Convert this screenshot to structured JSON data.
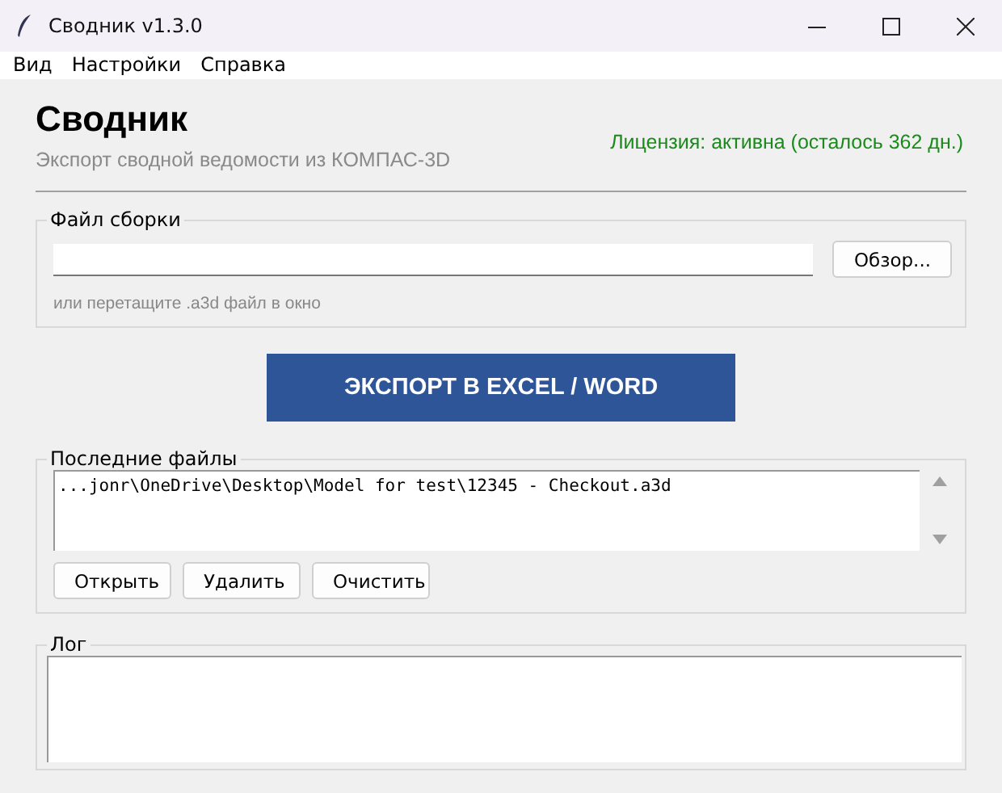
{
  "window": {
    "title": "Сводник v1.3.0"
  },
  "menu": [
    "Вид",
    "Настройки",
    "Справка"
  ],
  "header": {
    "title": "Сводник",
    "subtitle": "Экспорт сводной ведомости из КОМПАС-3D",
    "license": "Лицензия: активна (осталось 362 дн.)"
  },
  "file_group": {
    "legend": "Файл сборки",
    "browse": "Обзор...",
    "hint": "или перетащите .a3d файл в окно"
  },
  "export_button": "ЭКСПОРТ В EXCEL / WORD",
  "recent": {
    "legend": "Последние файлы",
    "items": [
      "...jonr\\OneDrive\\Desktop\\Model for test\\12345 - Checkout.a3d"
    ],
    "buttons": [
      "Открыть",
      "Удалить",
      "Очистить"
    ]
  },
  "log": {
    "legend": "Лог"
  }
}
